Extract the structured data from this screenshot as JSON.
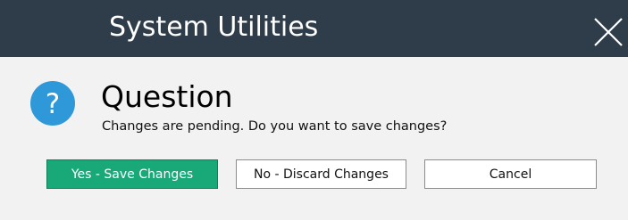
{
  "window": {
    "title": "System Utilities",
    "close_icon": "close-icon"
  },
  "dialog": {
    "icon": "question-icon",
    "icon_glyph": "?",
    "heading": "Question",
    "message": "Changes are pending. Do you want to save changes?"
  },
  "buttons": {
    "yes_label": "Yes - Save Changes",
    "no_label": "No - Discard Changes",
    "cancel_label": "Cancel"
  },
  "colors": {
    "titlebar_bg": "#2f3d4b",
    "body_bg": "#f2f2f2",
    "question_icon": "#2f98d9",
    "primary_button": "#19a877"
  }
}
